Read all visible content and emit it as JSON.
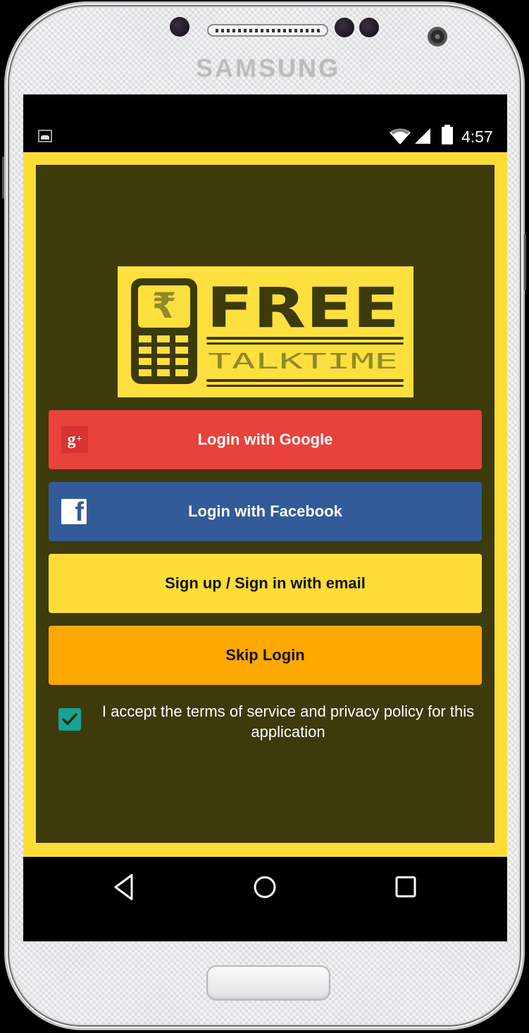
{
  "device": {
    "brand": "SAMSUNG"
  },
  "status_bar": {
    "time": "4:57",
    "icons": [
      "image-notification-icon",
      "wifi-icon",
      "cell-signal-icon",
      "battery-icon"
    ]
  },
  "logo": {
    "title": "FREE",
    "subtitle": "TALKTIME",
    "currency_symbol": "₹"
  },
  "buttons": {
    "google": {
      "label": "Login with Google",
      "icon": "google-plus-icon",
      "icon_text": "g+",
      "color": "#e8423a"
    },
    "facebook": {
      "label": "Login with Facebook",
      "icon": "facebook-icon",
      "icon_text": "f",
      "color": "#335a99"
    },
    "email": {
      "label": "Sign up / Sign in with email",
      "color": "#fedd37"
    },
    "skip": {
      "label": "Skip Login",
      "color": "#ffa800"
    }
  },
  "terms": {
    "checked": true,
    "text": "I accept the terms of service and privacy policy for this application"
  },
  "nav_bar": {
    "back": "back-icon",
    "home": "home-icon",
    "recents": "recents-icon"
  },
  "colors": {
    "app_border": "#fcdd34",
    "panel_bg": "#3d3a0b",
    "checkbox": "#17a393"
  }
}
